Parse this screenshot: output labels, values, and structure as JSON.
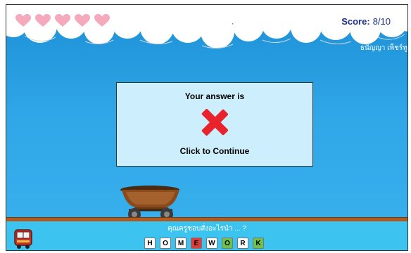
{
  "hud": {
    "lives_total": 5,
    "lives_remaining": 0,
    "heart_color": "#f4a9bd",
    "score_label": "Score:",
    "score_value": "8/10",
    "player_name": "ธนัญญา เพ็ชร์ทูล"
  },
  "dialog": {
    "title": "Your answer is",
    "result_icon": "red-x-icon",
    "result_color": "#e8232b",
    "continue_label": "Click to Continue"
  },
  "question": {
    "text": "คุณครูชอบสั่งอะไรนำ ... ?",
    "tiles": [
      {
        "letter": "H",
        "state": "neutral"
      },
      {
        "letter": "O",
        "state": "neutral"
      },
      {
        "letter": "M",
        "state": "neutral"
      },
      {
        "letter": "E",
        "state": "wrong"
      },
      {
        "letter": "W",
        "state": "neutral"
      },
      {
        "letter": "O",
        "state": "correct"
      },
      {
        "letter": "R",
        "state": "neutral"
      },
      {
        "letter": "K",
        "state": "correct"
      }
    ],
    "tile_colors": {
      "neutral": "#ffffff",
      "wrong": "#e23b3b",
      "correct": "#6cc24a"
    }
  },
  "icons": {
    "cart": "wheelbarrow-cart-icon",
    "bus": "bus-icon"
  }
}
